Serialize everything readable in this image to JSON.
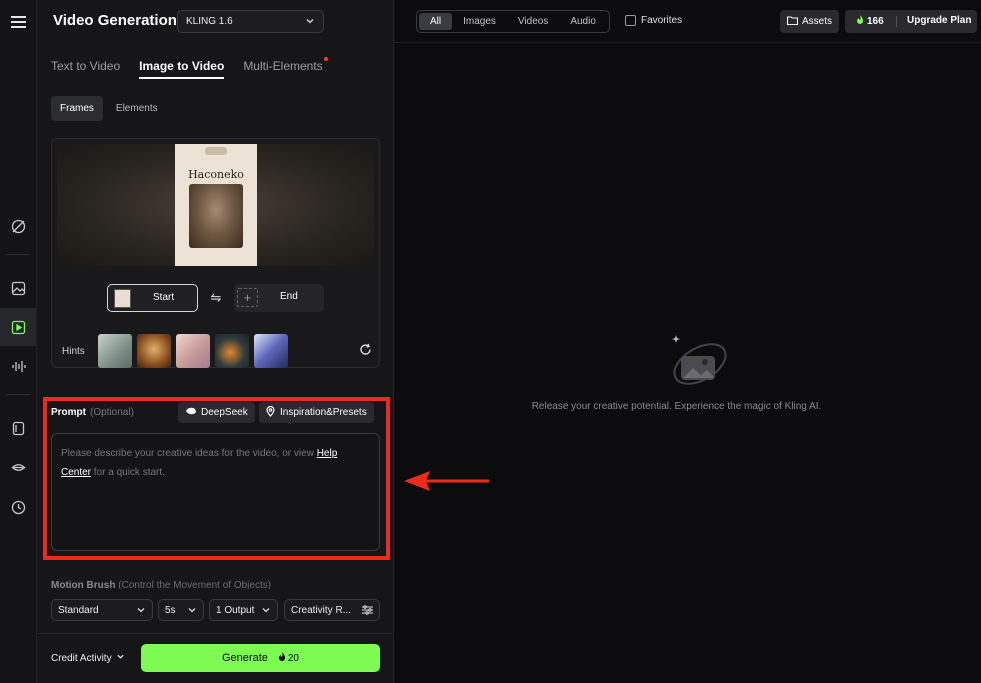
{
  "header": {
    "title": "Video Generation",
    "model": "KLING 1.6"
  },
  "tabs": [
    {
      "label": "Text to Video"
    },
    {
      "label": "Image to Video"
    },
    {
      "label": "Multi-Elements"
    }
  ],
  "subtabs": [
    {
      "label": "Frames"
    },
    {
      "label": "Elements"
    }
  ],
  "frames": {
    "preview_product_text": "Haconeko",
    "start_label": "Start",
    "end_label": "End",
    "hints_label": "Hints",
    "hint_colors": [
      "#9fb0a8",
      "#b07a3a",
      "#d8b7b0",
      "#2d3a3d",
      "#4e5aa0"
    ]
  },
  "prompt": {
    "label": "Prompt",
    "optional": "(Optional)",
    "deepseek": "DeepSeek",
    "inspiration": "Inspiration&Presets",
    "placeholder_before": "Please describe your creative ideas for the video, or view ",
    "placeholder_link": "Help Center",
    "placeholder_after": " for a quick start."
  },
  "motion_brush": {
    "label": "Motion Brush",
    "hint": "(Control the Movement of Objects)"
  },
  "settings": {
    "mode": "Standard",
    "duration": "5s",
    "outputs": "1 Output",
    "creativity": "Creativity R..."
  },
  "footer": {
    "credit_activity": "Credit Activity",
    "generate": "Generate",
    "cost": "20"
  },
  "filters": [
    {
      "label": "All"
    },
    {
      "label": "Images"
    },
    {
      "label": "Videos"
    },
    {
      "label": "Audio"
    }
  ],
  "favorites": "Favorites",
  "assets": "Assets",
  "credits": "166",
  "upgrade": "Upgrade Plan",
  "empty_state": "Release your creative potential. Experience the magic of Kling AI.",
  "colors": {
    "accent": "#7dfb52",
    "highlight": "#ee2a1b"
  }
}
